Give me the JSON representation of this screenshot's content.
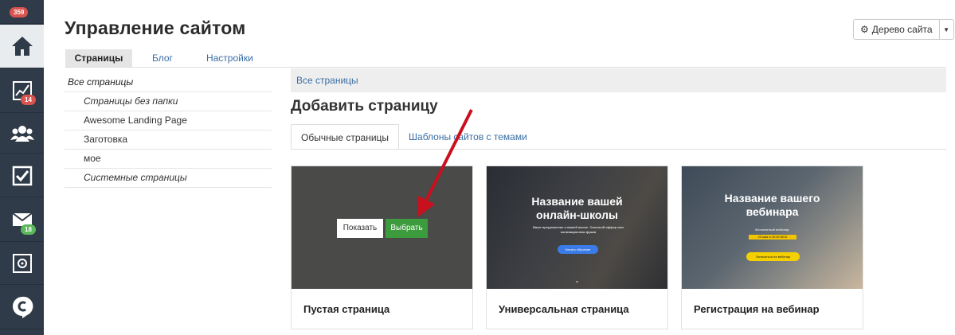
{
  "rail": {
    "top_badge": "359",
    "items": [
      {
        "icon": "home-icon",
        "badge": ""
      },
      {
        "icon": "chart-icon",
        "badge": "14"
      },
      {
        "icon": "users-icon",
        "badge": ""
      },
      {
        "icon": "checkbox-icon",
        "badge": ""
      },
      {
        "icon": "mail-icon",
        "badge": "18"
      },
      {
        "icon": "safe-icon",
        "badge": ""
      },
      {
        "icon": "logo-c-icon",
        "badge": ""
      }
    ]
  },
  "header": {
    "title": "Управление сайтом",
    "site_tree_button": "Дерево сайта"
  },
  "top_tabs": [
    "Страницы",
    "Блог",
    "Настройки"
  ],
  "folders": [
    {
      "label": "Все страницы"
    },
    {
      "label": "Страницы без папки"
    },
    {
      "label": "Awesome Landing Page"
    },
    {
      "label": "Заготовка"
    },
    {
      "label": "мое"
    },
    {
      "label": "Системные страницы"
    }
  ],
  "breadcrumb": "Все страницы",
  "add_title": "Добавить страницу",
  "sub_tabs": [
    "Обычные страницы",
    "Шаблоны сайтов с темами"
  ],
  "cards": [
    {
      "label": "Пустая страница",
      "show_button": "Показать",
      "choose_button": "Выбрать"
    },
    {
      "label": "Универсальная страница",
      "thumb_title_1": "Название вашей",
      "thumb_title_2": "онлайн-школы",
      "thumb_sub": "Ваше предложение о вашей школе. Сильный оффер или мотивационная фраза",
      "thumb_button": "Начать обучение"
    },
    {
      "label": "Регистрация на вебинар",
      "thumb_title_1": "Название вашего",
      "thumb_title_2": "вебинара",
      "thumb_sub": "Бесплатный вебинар",
      "thumb_date": "20 мая в 20:00 МСК",
      "thumb_button": "Записаться на вебинар"
    }
  ],
  "colors": {
    "rail_bg": "#2f3b48",
    "accent_link": "#3a6ea5",
    "choose_green": "#3c9b3c",
    "arrow_red": "#c8101e"
  }
}
